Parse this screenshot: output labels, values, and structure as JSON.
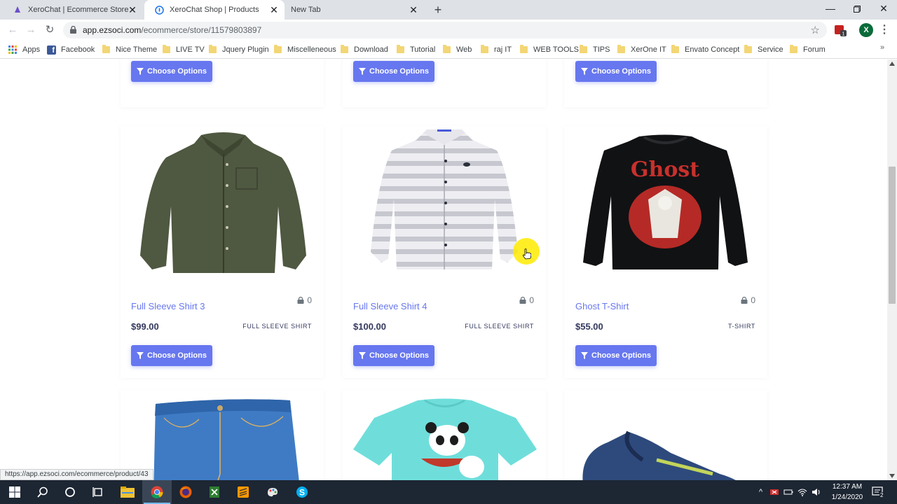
{
  "browser": {
    "tabs": [
      {
        "title": "XeroChat | Ecommerce Store",
        "active": false
      },
      {
        "title": "XeroChat Shop | Products",
        "active": true
      },
      {
        "title": "New Tab",
        "active": false
      }
    ],
    "url_host": "app.ezsoci.com",
    "url_path": "/ecommerce/store/11579803897",
    "profile_initial": "X",
    "ext_badge": "1",
    "bookmarks": [
      "Apps",
      "Facebook",
      "Nice Theme",
      "LIVE TV",
      "Jquery Plugin",
      "Miscelleneous",
      "Download",
      "Tutorial",
      "Web",
      "raj IT",
      "WEB TOOLS",
      "TIPS",
      "XerOne IT",
      "Envato Concept",
      "Service",
      "Forum"
    ],
    "status_url": "https://app.ezsoci.com/ecommerce/product/43"
  },
  "store": {
    "choose_label": "Choose Options",
    "products": [
      {
        "name": "Full Sleeve Shirt 3",
        "price": "$99.00",
        "category": "FULL SLEEVE SHIRT",
        "count": "0",
        "image": "olive-shirt"
      },
      {
        "name": "Full Sleeve Shirt 4",
        "price": "$100.00",
        "category": "FULL SLEEVE SHIRT",
        "count": "0",
        "image": "striped-shirt"
      },
      {
        "name": "Ghost T-Shirt",
        "price": "$55.00",
        "category": "T-SHIRT",
        "count": "0",
        "image": "ghost-longsleeve"
      }
    ],
    "next_row_images": [
      "blue-jeans",
      "panda-tshirt",
      "blue-sneaker"
    ]
  },
  "taskbar": {
    "time": "12:37 AM",
    "date": "1/24/2020",
    "notification_count": "2",
    "apps": [
      "start-icon",
      "search-icon",
      "cortana-icon",
      "task-view-icon",
      "file-explorer-icon",
      "chrome-icon",
      "firefox-icon",
      "excel-icon",
      "sublime-icon",
      "paint-icon",
      "skype-icon"
    ]
  },
  "colors": {
    "accent": "#6777ef",
    "text_dark": "#34395e",
    "taskbar": "#1d2633"
  }
}
